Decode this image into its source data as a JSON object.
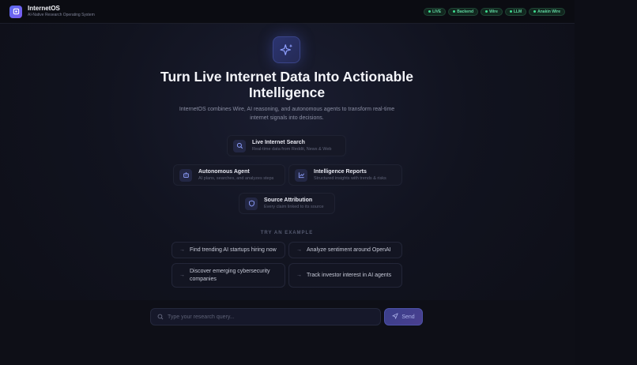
{
  "header": {
    "brand_title": "InternetOS",
    "brand_subtitle": "AI-Native Research Operating System",
    "status_pills": [
      "LIVE",
      "Backend",
      "Wire",
      "LLM",
      "Anakin Wire"
    ]
  },
  "hero": {
    "title_line1": "Turn Live Internet Data Into Actionable",
    "title_line2": "Intelligence",
    "subtitle": "InternetOS combines Wire, AI reasoning, and autonomous agents to transform real-time internet signals into decisions."
  },
  "features": [
    {
      "title": "Live Internet Search",
      "desc": "Real-time data from Reddit, News & Web",
      "icon": "search-icon"
    },
    {
      "title": "Autonomous Agent",
      "desc": "AI plans, searches, and analyzes steps",
      "icon": "robot-icon"
    },
    {
      "title": "Intelligence Reports",
      "desc": "Structured insights with trends & risks",
      "icon": "chart-icon"
    },
    {
      "title": "Source Attribution",
      "desc": "Every claim linked to its source",
      "icon": "shield-icon"
    }
  ],
  "examples": {
    "label": "TRY AN EXAMPLE",
    "items": [
      "Find trending AI startups hiring now",
      "Analyze sentiment around OpenAI",
      "Discover emerging cybersecurity companies",
      "Track investor interest in AI agents"
    ]
  },
  "composer": {
    "placeholder": "Type your research query...",
    "send_label": "Send"
  },
  "colors": {
    "accent": "#5b6cf0",
    "status_green": "#3ddc8f",
    "background": "#0d0e16"
  }
}
